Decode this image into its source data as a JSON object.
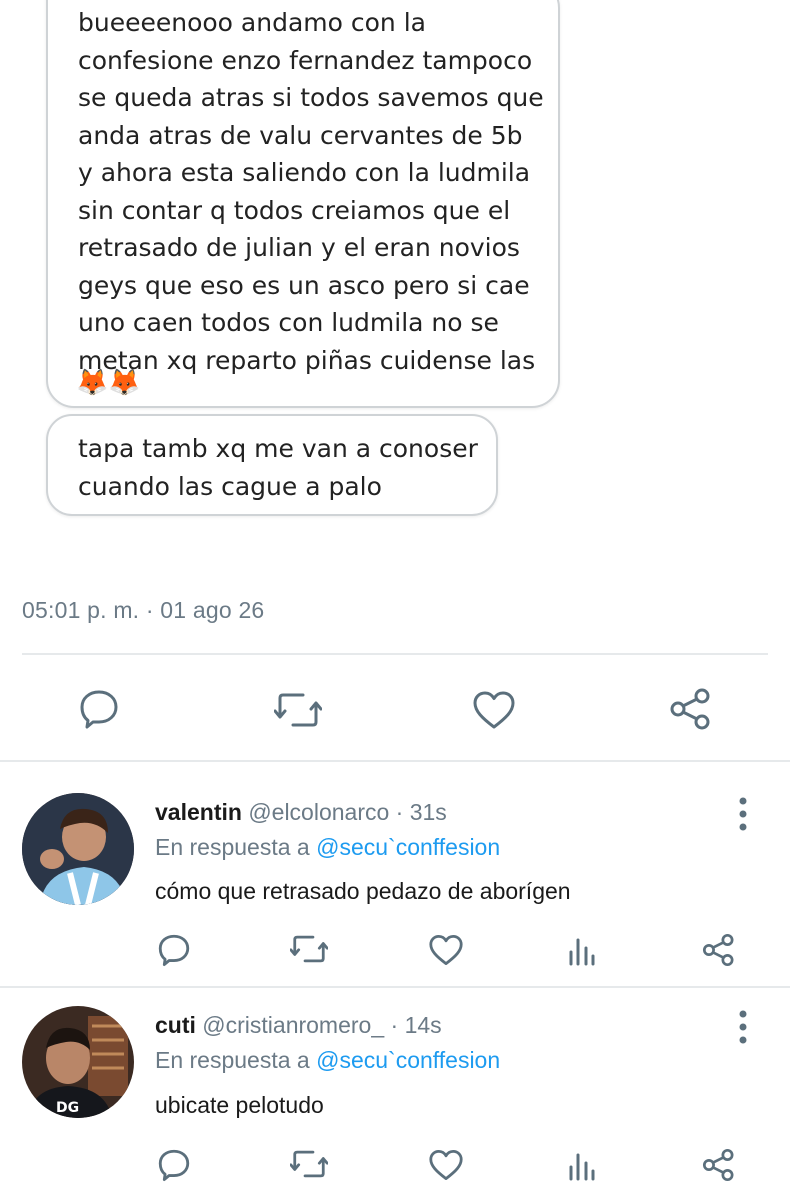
{
  "tweet": {
    "confession_text": "bueeeenooo andamo con la\nconfesione enzo fernandez tampoco\nse queda atras si todos savemos que\nanda atras de valu  cervantes de 5b\ny ahora esta saliendo con la ludmila\nsin contar q todos creiamos que el\nretrasado de julian y el eran novios\ngeys que eso es un asco pero si cae\nuno caen todos con ludmila no se\nmetan xq reparto piñas cuidense las",
    "confession_emoji": "🦊🦊",
    "followup_text": "tapa tamb xq me van a conoser\ncuando las cague a palo",
    "timestamp": "05:01 p. m. · 01 ago 26",
    "actions": [
      "reply-icon",
      "retweet-icon",
      "like-icon",
      "share-icon"
    ]
  },
  "replies": [
    {
      "name": "valentin",
      "handle": "@elcolonarco · 31s",
      "reply_prefix": "En respuesta a ",
      "reply_mention": "@secu`conffesion",
      "text": "cómo que retrasado pedazo de aborígen",
      "actions": [
        "reply-icon",
        "retweet-icon",
        "like-icon",
        "analytics-icon",
        "share-icon"
      ]
    },
    {
      "name": "cuti",
      "handle": "@cristianromero_ · 14s",
      "reply_prefix": "En respuesta a ",
      "reply_mention": "@secu`conffesion",
      "text": "ubicate pelotudo",
      "actions": [
        "reply-icon",
        "retweet-icon",
        "like-icon",
        "analytics-icon",
        "share-icon"
      ]
    }
  ],
  "colors": {
    "meta_gray": "#6b7a86",
    "mention_blue": "#1d9bf0",
    "icon_gray": "#5b6f7c",
    "divider": "#e6e9eb"
  }
}
